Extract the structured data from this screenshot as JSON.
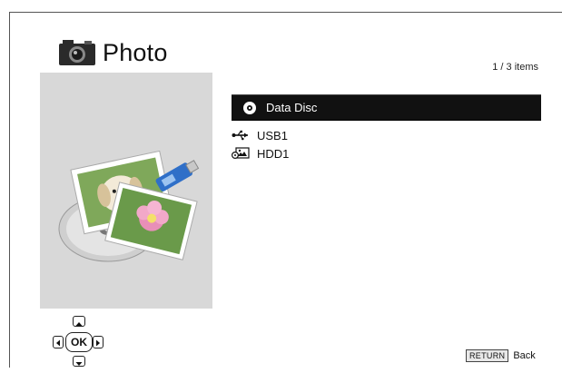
{
  "header": {
    "title": "Photo",
    "icon": "camera-icon"
  },
  "item_count": "1 / 3 items",
  "devices": [
    {
      "label": "Data Disc",
      "icon": "disc-icon",
      "selected": true
    },
    {
      "label": "USB1",
      "icon": "usb-icon",
      "selected": false
    },
    {
      "label": "HDD1",
      "icon": "hdd-icon",
      "selected": false
    }
  ],
  "nav": {
    "ok_label": "OK"
  },
  "footer": {
    "return_key": "RETURN",
    "return_label": "Back"
  },
  "colors": {
    "selected_bg": "#111111",
    "panel_bg": "#d8d8d8"
  }
}
